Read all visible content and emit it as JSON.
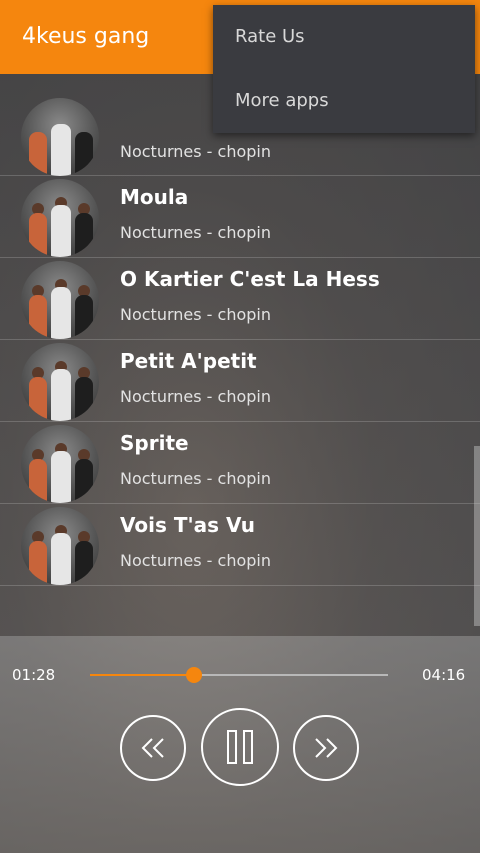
{
  "app": {
    "title": "4keus gang"
  },
  "menu": {
    "items": [
      "Rate Us",
      "More apps"
    ]
  },
  "songs": [
    {
      "title": "",
      "artist": "Nocturnes - chopin"
    },
    {
      "title": "Moula",
      "artist": "Nocturnes - chopin"
    },
    {
      "title": "O Kartier C'est La Hess",
      "artist": "Nocturnes - chopin"
    },
    {
      "title": "Petit A'petit",
      "artist": "Nocturnes - chopin"
    },
    {
      "title": "Sprite",
      "artist": "Nocturnes - chopin"
    },
    {
      "title": "Vois T'as Vu",
      "artist": "Nocturnes - chopin"
    }
  ],
  "player": {
    "current_time": "01:28",
    "total_time": "04:16",
    "progress_fraction": 0.348,
    "controls": [
      "rewind-icon",
      "pause-icon",
      "fast-forward-icon"
    ]
  },
  "colors": {
    "accent": "#f5860e",
    "menu_bg": "#3a3b40"
  }
}
